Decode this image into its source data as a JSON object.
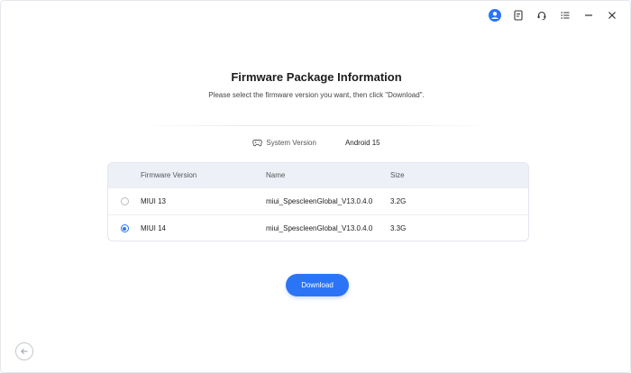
{
  "titlebar": {
    "icons": [
      "user-account-icon",
      "feedback-icon",
      "support-headset-icon",
      "menu-icon",
      "minimize-icon",
      "close-icon"
    ]
  },
  "page": {
    "title": "Firmware Package Information",
    "subtitle": "Please select the firmware version you want, then click \"Download\"."
  },
  "system": {
    "label": "System Version",
    "value": "Android 15"
  },
  "table": {
    "headers": {
      "version": "Firmware Version",
      "name": "Name",
      "size": "Size"
    },
    "rows": [
      {
        "version": "MIUI 13",
        "name": "miui_SpescleenGlobal_V13.0.4.0",
        "size": "3.2G",
        "selected": false
      },
      {
        "version": "MIUI 14",
        "name": "miui_SpescleenGlobal_V13.0.4.0",
        "size": "3.3G",
        "selected": true
      }
    ]
  },
  "actions": {
    "download_label": "Download"
  },
  "colors": {
    "accent": "#2b74f5",
    "header_bg": "#eef0f8"
  }
}
